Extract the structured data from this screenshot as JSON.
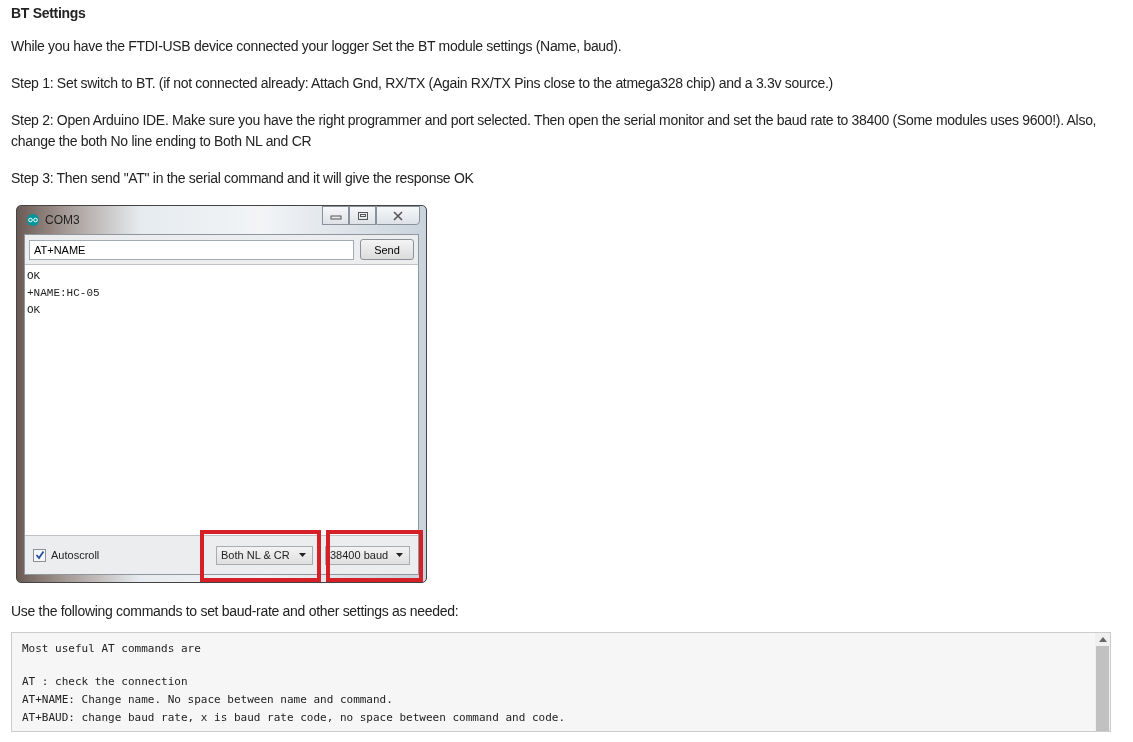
{
  "heading": "BT Settings",
  "paragraphs": [
    "While you have the FTDI-USB device connected your logger Set the BT module settings (Name, baud).",
    "Step 1: Set switch to BT. (if not connected already: Attach Gnd, RX/TX (Again RX/TX Pins close to the atmega328 chip) and a 3.3v source.)",
    "Step 2: Open Arduino IDE. Make sure you have the right programmer and port selected. Then open the serial monitor and set the baud rate to 38400 (Some modules uses 9600!). Also, change the both No line ending to Both NL and CR",
    "Step 3: Then send \"AT\" in the serial command and it will give the response OK"
  ],
  "serial_monitor": {
    "title": "COM3",
    "command": "AT+NAME",
    "send_label": "Send",
    "output": [
      "OK",
      "+NAME:HC-05",
      "OK"
    ],
    "autoscroll": {
      "label": "Autoscroll",
      "checked": true
    },
    "line_ending": "Both NL & CR",
    "baud": "38400 baud"
  },
  "after_text": "Use the following commands to set baud-rate and other settings as needed:",
  "code_block": {
    "groups": [
      [
        "Most useful AT commands are"
      ],
      [
        "AT : check the connection",
        "AT+NAME: Change name. No space between name and command.",
        "AT+BAUD: change baud rate, x is baud rate code, no space between command and code."
      ]
    ]
  }
}
